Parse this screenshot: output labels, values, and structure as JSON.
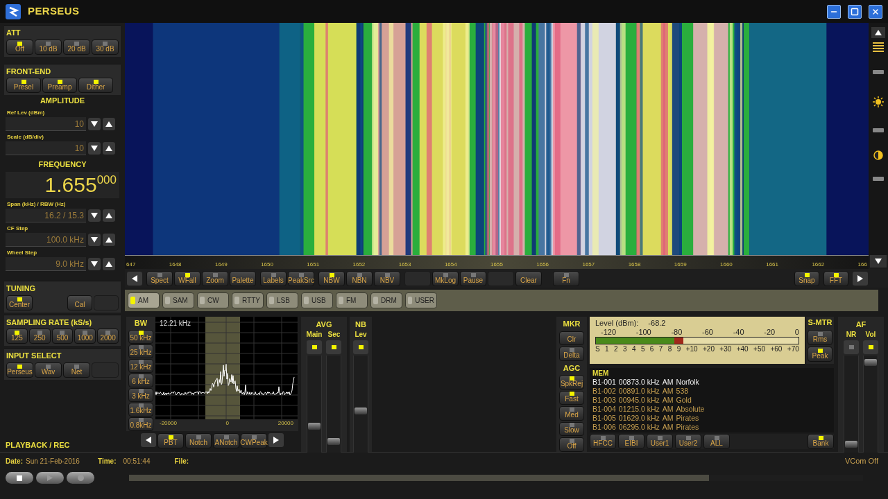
{
  "window": {
    "title": "PERSEUS"
  },
  "att": {
    "title": "ATT",
    "buttons": [
      {
        "label": "Off",
        "on": true
      },
      {
        "label": "10 dB",
        "on": false
      },
      {
        "label": "20 dB",
        "on": false
      },
      {
        "label": "30 dB",
        "on": false
      }
    ]
  },
  "front_end": {
    "title": "FRONT-END",
    "buttons": [
      {
        "label": "Presel",
        "on": true
      },
      {
        "label": "Preamp",
        "on": true
      },
      {
        "label": "Dither",
        "on": true
      }
    ]
  },
  "amplitude": {
    "title": "AMPLITUDE",
    "fields": [
      {
        "label": "Ref Lev (dBm)",
        "value": "10"
      },
      {
        "label": "Scale (dB/div)",
        "value": "10"
      }
    ]
  },
  "frequency": {
    "title": "FREQUENCY",
    "main": "1.655",
    "fine": "000",
    "fields": [
      {
        "label": "Span (kHz) / RBW (Hz)",
        "value": "16.2 / 15.3"
      },
      {
        "label": "CF Step",
        "value": "100.0 kHz"
      },
      {
        "label": "Wheel Step",
        "value": "9.0 kHz"
      }
    ]
  },
  "tuning": {
    "title": "TUNING",
    "buttons": [
      {
        "kind": "led",
        "label": "Center",
        "on": true
      },
      {
        "kind": "plain",
        "label": "Cal"
      },
      {
        "kind": "blank"
      }
    ]
  },
  "sampling": {
    "title": "SAMPLING RATE (kS/s)",
    "buttons": [
      {
        "label": "125",
        "on": true
      },
      {
        "label": "250",
        "on": false
      },
      {
        "label": "500",
        "on": false
      },
      {
        "label": "1000",
        "on": false
      },
      {
        "label": "2000",
        "on": false
      }
    ]
  },
  "input_select": {
    "title": "INPUT SELECT",
    "buttons": [
      {
        "kind": "led",
        "label": "Perseus",
        "on": true
      },
      {
        "kind": "led",
        "label": "Wav",
        "on": false
      },
      {
        "kind": "led",
        "label": "Net",
        "on": false
      },
      {
        "kind": "blank"
      }
    ]
  },
  "playback": {
    "title": "PLAYBACK / REC",
    "level": 0.79
  },
  "scale": {
    "labels": [
      "647",
      "1648",
      "1649",
      "1650",
      "1651",
      "1652",
      "1653",
      "1654",
      "1655",
      "1656",
      "1657",
      "1658",
      "1659",
      "1660",
      "1661",
      "1662",
      "166"
    ]
  },
  "toolbar": {
    "groups": [
      [
        {
          "kind": "led",
          "label": "Spect",
          "on": false
        },
        {
          "kind": "led",
          "label": "WFall",
          "on": true
        },
        {
          "kind": "led",
          "label": "Zoom",
          "on": false
        },
        {
          "kind": "plain",
          "label": "Palette"
        }
      ],
      [
        {
          "kind": "led",
          "label": "Labels",
          "on": false
        },
        {
          "kind": "led",
          "label": "PeakSrc",
          "on": false
        }
      ],
      [
        {
          "kind": "led",
          "label": "NBW",
          "on": true
        },
        {
          "kind": "led",
          "label": "NBN",
          "on": false
        },
        {
          "kind": "led",
          "label": "NBV",
          "on": false
        }
      ],
      [
        {
          "kind": "blank"
        },
        {
          "kind": "led",
          "label": "MkLog",
          "on": false
        },
        {
          "kind": "led",
          "label": "Pause",
          "on": false
        },
        {
          "kind": "blank"
        },
        {
          "kind": "plain",
          "label": "Clear"
        }
      ],
      [
        {
          "kind": "led",
          "label": "Fn",
          "on": false
        }
      ]
    ],
    "right": [
      {
        "label": "Snap",
        "on": true
      },
      {
        "label": "FFT",
        "on": true
      }
    ]
  },
  "modes": [
    {
      "label": "AM",
      "selected": true
    },
    {
      "label": "SAM",
      "selected": false
    },
    {
      "label": "CW",
      "selected": false
    },
    {
      "label": "RTTY",
      "selected": false
    },
    {
      "label": "LSB",
      "selected": false
    },
    {
      "label": "USB",
      "selected": false
    },
    {
      "label": "FM",
      "selected": false
    },
    {
      "label": "DRM",
      "selected": false
    },
    {
      "label": "USER",
      "selected": false
    }
  ],
  "bw": {
    "title": "BW",
    "buttons": [
      {
        "label": "50 kHz",
        "on": true
      },
      {
        "label": "25 kHz",
        "on": false
      },
      {
        "label": "12 kHz",
        "on": false
      },
      {
        "label": "6 kHz",
        "on": false
      },
      {
        "label": "3 kHz",
        "on": false
      },
      {
        "label": "1.6kHz",
        "on": false
      },
      {
        "label": "0.8kHz",
        "on": false
      }
    ]
  },
  "scope": {
    "readout": "12.21 kHz",
    "x_labels": [
      "-20000",
      "0",
      "20000"
    ],
    "buttons": [
      {
        "label": "PBT",
        "on": true
      },
      {
        "label": "Notch",
        "on": false
      },
      {
        "label": "ANotch",
        "on": false
      },
      {
        "label": "CWPeak",
        "on": false
      }
    ]
  },
  "avg": {
    "title": "AVG",
    "channels": [
      {
        "label": "Main",
        "on": true,
        "level": 0.25
      },
      {
        "label": "Sec",
        "on": true,
        "level": 0.08
      }
    ]
  },
  "nb": {
    "title": "NB",
    "channels": [
      {
        "label": "Lev",
        "on": true,
        "level": 0.42
      }
    ]
  },
  "mkr": {
    "title": "MKR",
    "buttons": [
      {
        "kind": "plain",
        "label": "Clr"
      },
      {
        "kind": "led",
        "label": "Delta",
        "on": false
      }
    ]
  },
  "agc": {
    "title": "AGC",
    "buttons": [
      {
        "label": "SpkRej",
        "on": true
      },
      {
        "label": "Fast",
        "on": true
      },
      {
        "label": "Med",
        "on": false
      },
      {
        "label": "Slow",
        "on": false
      },
      {
        "label": "Off",
        "on": false
      }
    ]
  },
  "meter": {
    "label": "Level (dBm):",
    "reading": "-68.2",
    "scale": [
      "-120",
      "-100",
      "-80",
      "-60",
      "-40",
      "-20",
      "0"
    ],
    "level": 0.43,
    "s_scale": [
      "S",
      "1",
      "2",
      "3",
      "4",
      "5",
      "6",
      "7",
      "8",
      "9",
      "+10",
      "+20",
      "+30",
      "+40",
      "+50",
      "+60",
      "+70"
    ]
  },
  "s_meter": {
    "title": "S-MTR",
    "buttons": [
      {
        "label": "Rms",
        "on": false
      },
      {
        "label": "Peak",
        "on": true
      }
    ]
  },
  "af": {
    "title": "AF",
    "channels": [
      {
        "label": "NR",
        "on": false,
        "level": 0.05
      },
      {
        "label": "Vol",
        "on": true,
        "level": 0.96
      }
    ]
  },
  "mem": {
    "title": "MEM",
    "rows": [
      {
        "id": "B1-001",
        "freq": "00873.0 kHz",
        "mode": "AM",
        "name": "Norfolk",
        "selected": true
      },
      {
        "id": "B1-002",
        "freq": "00891.0 kHz",
        "mode": "AM",
        "name": "538",
        "selected": false
      },
      {
        "id": "B1-003",
        "freq": "00945.0 kHz",
        "mode": "AM",
        "name": "Gold",
        "selected": false
      },
      {
        "id": "B1-004",
        "freq": "01215.0 kHz",
        "mode": "AM",
        "name": "Absolute",
        "selected": false
      },
      {
        "id": "B1-005",
        "freq": "01629.0 kHz",
        "mode": "AM",
        "name": "Pirates",
        "selected": false
      },
      {
        "id": "B1-006",
        "freq": "06295.0 kHz",
        "mode": "AM",
        "name": "Pirates",
        "selected": false
      }
    ],
    "buttons": [
      {
        "label": "HFCC",
        "on": false
      },
      {
        "label": "EIBI",
        "on": false
      },
      {
        "label": "User1",
        "on": false
      },
      {
        "label": "User2",
        "on": false
      },
      {
        "label": "ALL",
        "on": false
      }
    ],
    "bank": {
      "label": "Bank",
      "on": true
    }
  },
  "status": {
    "date_label": "Date:",
    "date": "Sun 21-Feb-2016",
    "time_label": "Time:",
    "time": "00:51:44",
    "file_label": "File:",
    "vcom": "VCom Off"
  }
}
